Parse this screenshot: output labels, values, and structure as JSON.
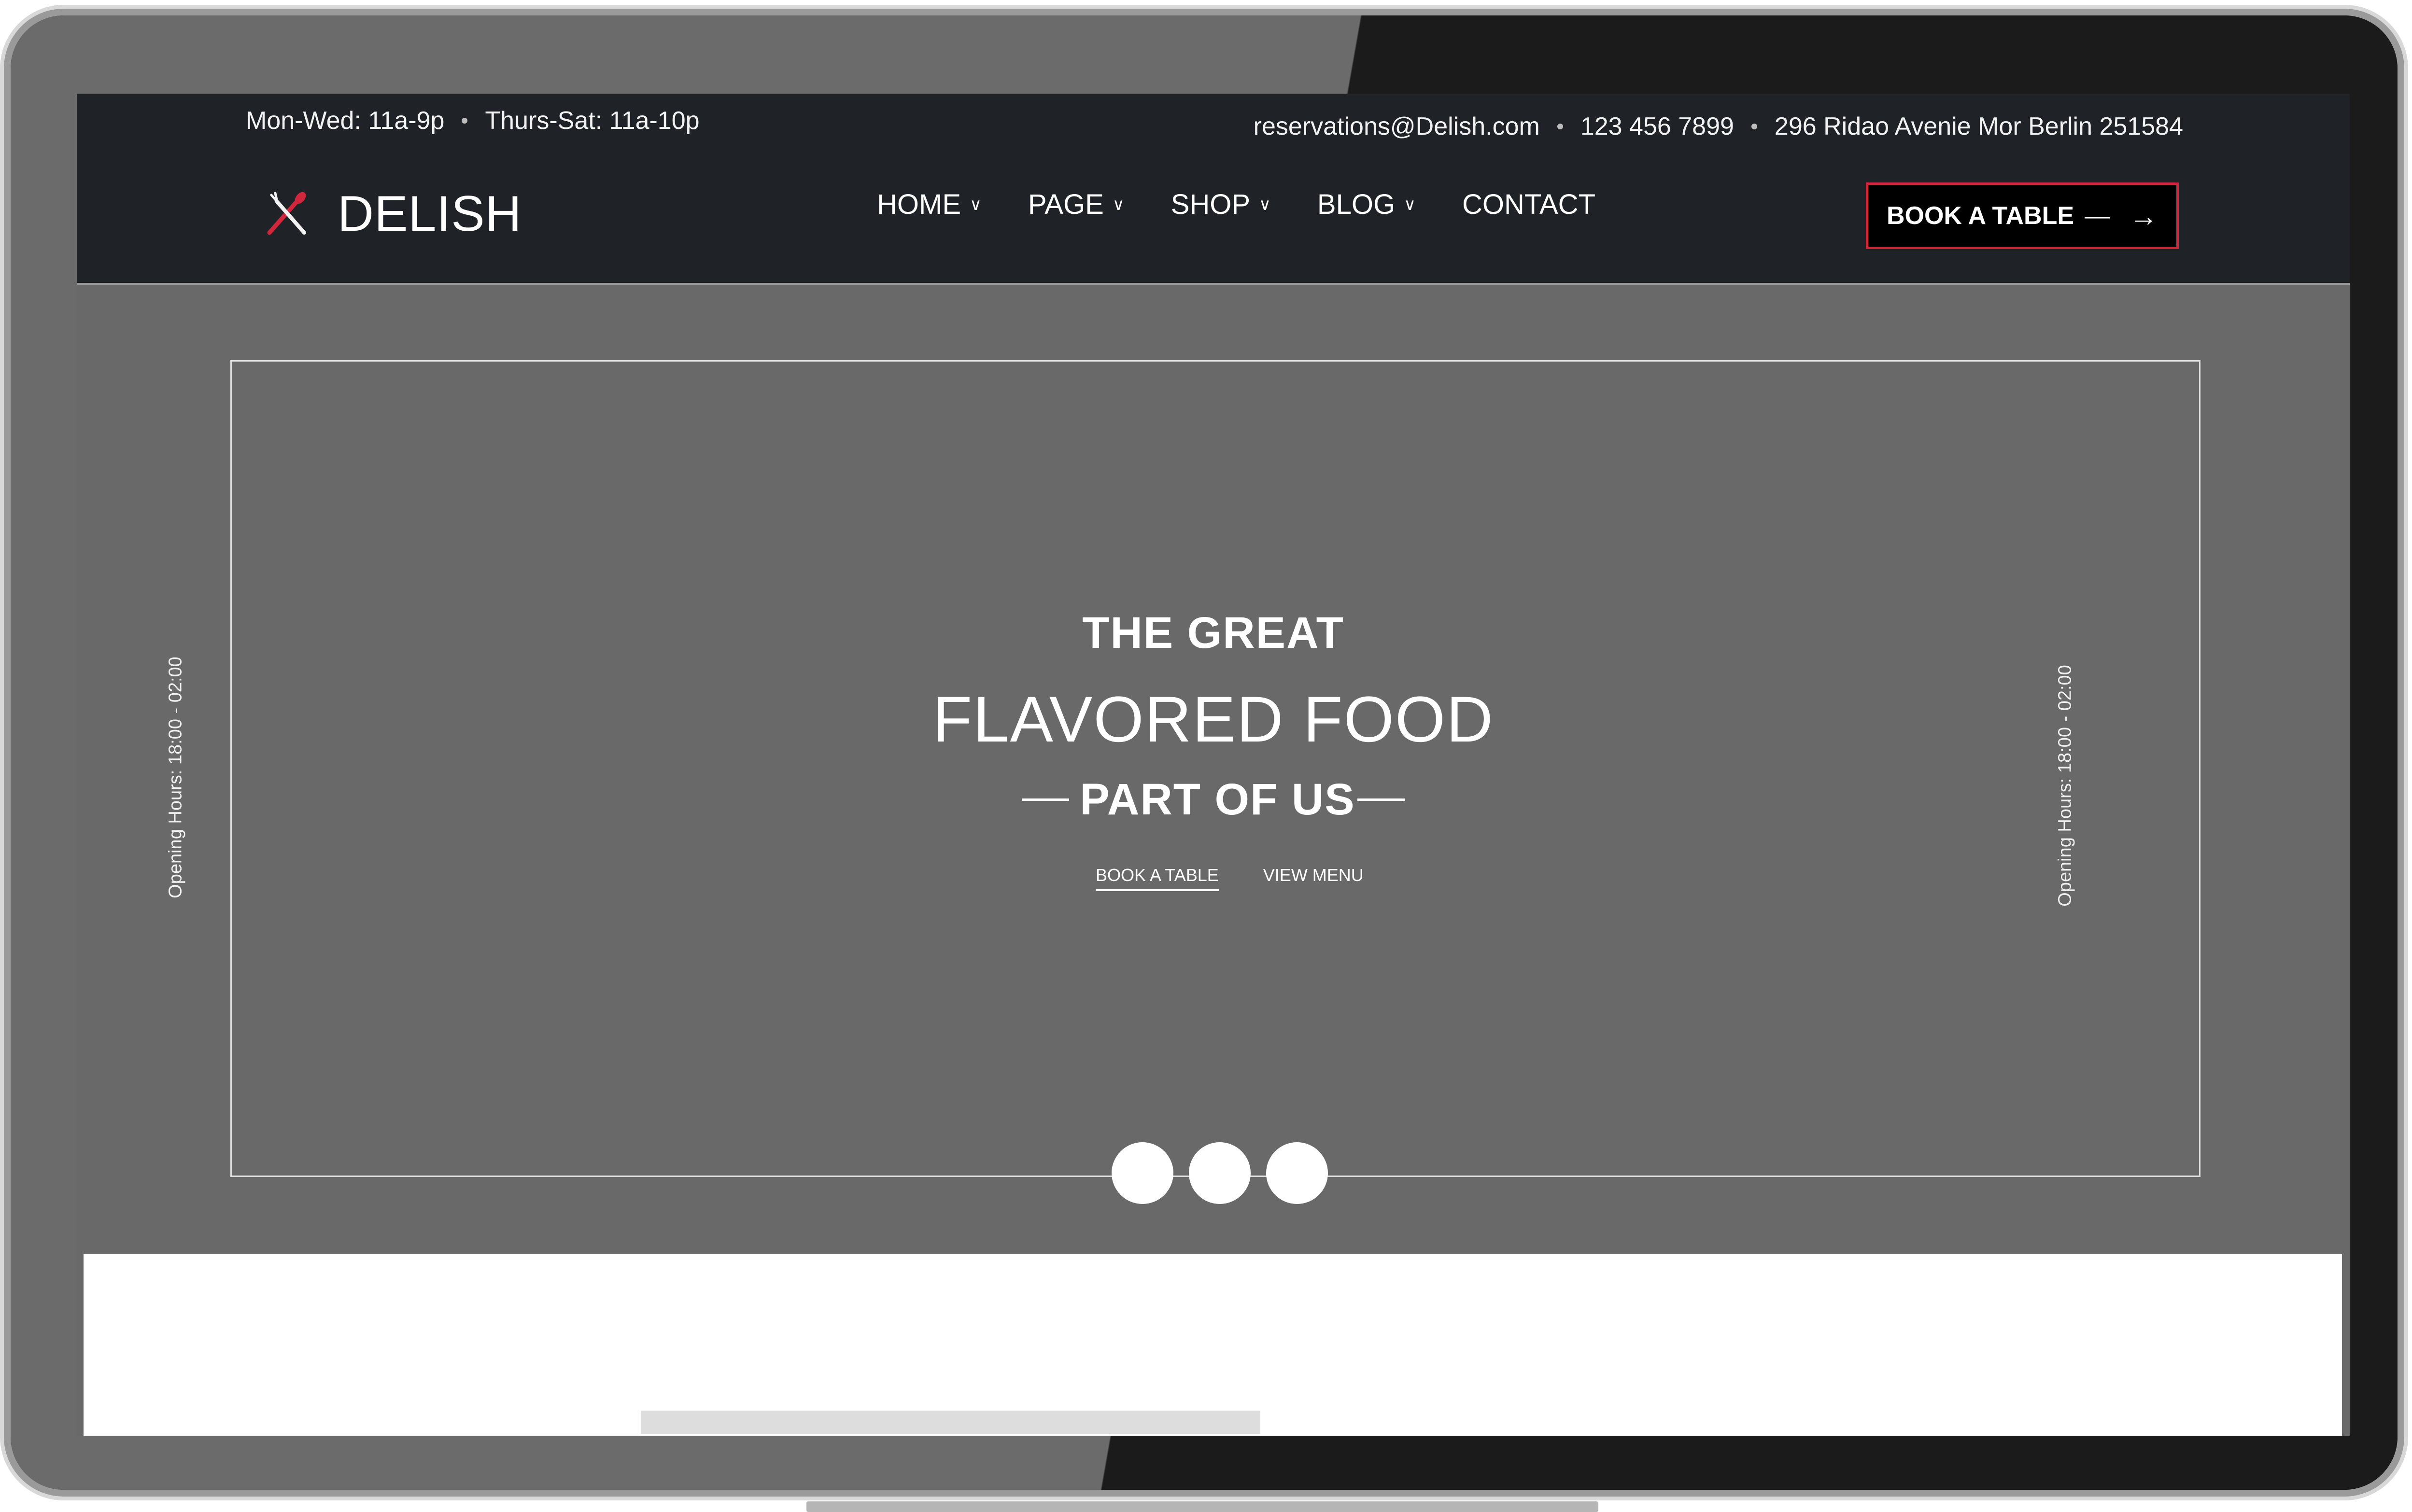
{
  "topbar": {
    "hours_weekday": "Mon-Wed: 11a-9p",
    "hours_weekend": "Thurs-Sat: 11a-10p",
    "email": "reservations@Delish.com",
    "phone": "123 456 7899",
    "address": "296 Ridao Avenie Mor Berlin 251584"
  },
  "brand": {
    "name": "DELISH",
    "icon": "crossed-utensils-icon",
    "accent": "#d1273c"
  },
  "nav": {
    "items": [
      {
        "label": "HOME",
        "has_dropdown": true
      },
      {
        "label": "PAGE",
        "has_dropdown": true
      },
      {
        "label": "SHOP",
        "has_dropdown": true
      },
      {
        "label": "BLOG",
        "has_dropdown": true
      },
      {
        "label": "CONTACT",
        "has_dropdown": false
      }
    ],
    "book_button": "BOOK A TABLE",
    "book_button_dash": "—",
    "book_button_arrow": "→"
  },
  "hero": {
    "line1": "THE GREAT",
    "line2": "FLAVORED FOOD",
    "line3": "PART OF US",
    "link_book": "BOOK A TABLE",
    "link_menu": "VIEW MENU",
    "side_text_left": "Opening Hours: 18:00 - 02:00",
    "side_text_right": "Opening Hours: 18:00 - 02:00",
    "slider_dots": 3
  },
  "colors": {
    "header_bg": "#1f2226",
    "hero_bg": "#696969",
    "accent": "#d1273c"
  }
}
